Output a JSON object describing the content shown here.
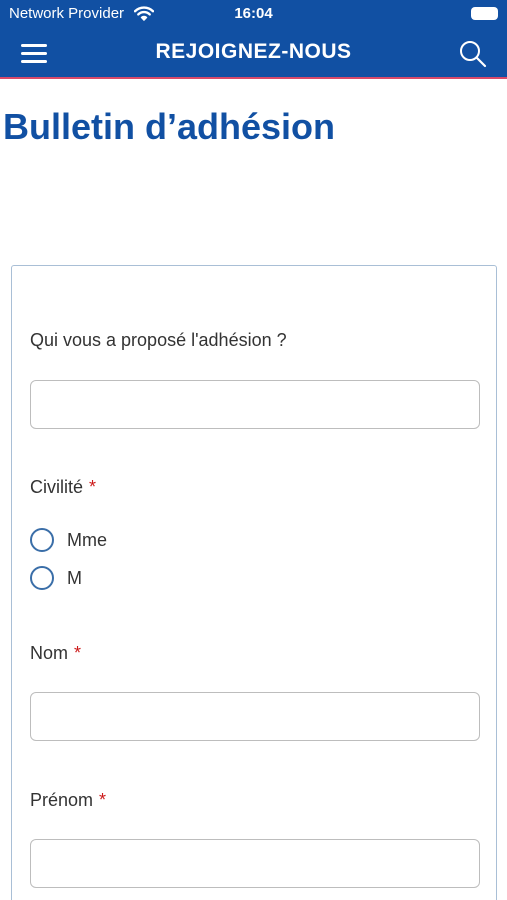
{
  "status_bar": {
    "carrier": "Network Provider",
    "time": "16:04",
    "wifi_icon": "wifi-icon",
    "battery_icon": "battery-icon"
  },
  "nav": {
    "title": "REJOIGNEZ-NOUS",
    "menu_icon": "hamburger-menu-icon",
    "search_icon": "search-icon"
  },
  "page": {
    "title": "Bulletin d’adhésion"
  },
  "form": {
    "referrer": {
      "label": "Qui vous a proposé l'adhésion ?",
      "value": ""
    },
    "civility": {
      "label": "Civilité",
      "required_mark": "*",
      "options": [
        {
          "label": "Mme",
          "selected": false
        },
        {
          "label": "M",
          "selected": false
        }
      ]
    },
    "last_name": {
      "label": "Nom",
      "required_mark": "*",
      "value": ""
    },
    "first_name": {
      "label": "Prénom",
      "required_mark": "*",
      "value": ""
    }
  },
  "colors": {
    "brand_blue": "#1150a3",
    "required_red": "#cc1a1a",
    "header_accent_line": "#d84a6a"
  }
}
